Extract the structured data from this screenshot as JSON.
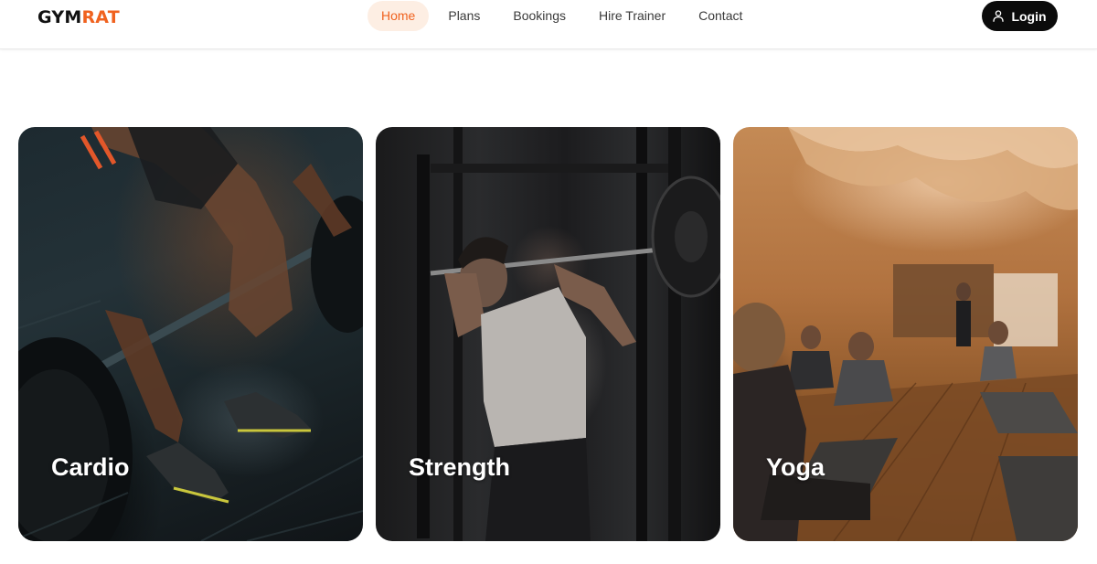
{
  "header": {
    "logo_part1": "GYM",
    "logo_part2": "RAT",
    "nav": [
      {
        "label": "Home",
        "active": true
      },
      {
        "label": "Plans",
        "active": false
      },
      {
        "label": "Bookings",
        "active": false
      },
      {
        "label": "Hire Trainer",
        "active": false
      },
      {
        "label": "Contact",
        "active": false
      }
    ],
    "login_label": "Login",
    "login_icon": "user-icon"
  },
  "cards": [
    {
      "label": "Cardio",
      "image": "photo of a person lifting a barbell in a gym"
    },
    {
      "label": "Strength",
      "image": "photo of a man doing barbell squats in a squat rack"
    },
    {
      "label": "Yoga",
      "image": "photo of a yoga class in a warm decorated studio"
    }
  ],
  "colors": {
    "accent": "#f0621f",
    "active_nav_bg": "#fdeee3",
    "login_bg": "#0b0b0b",
    "text": "#3a3a3a"
  }
}
